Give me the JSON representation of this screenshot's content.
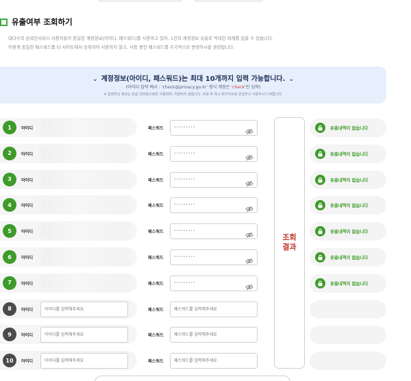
{
  "section": {
    "title": "유출여부 조회하기",
    "desc_line1": "대다수의 온라인서비스 사용자들이 동일한 계정정보(아이디, 패스워드)를 사용하고 있어, 1건의 계정정보 유출로 막대한 피해를 입을 수 있습니다.",
    "desc_line2": "이렇게 동일한 패스워드를 타 사이트에서 송복하여 사용하지 말고, 사용 중인 패스워드를 주기적으로 변경하시을 권장합니다."
  },
  "banner": {
    "title": "계정정보(아이디, 패스워드)는 최대 10개까지 입력 가능합니다.",
    "example_prefix": "(아이디 입력 예시 : 'check@privacy.go.kr' 형식 계정은 '",
    "example_highlight": "check",
    "example_suffix": "'만 입력)",
    "note": "※ 입력하신 정보는 단순 대조용으로만 사용되며, 저장되지 않습니다. 조회 후 즉시 파기되므로 안심하고 사용하시기 바랍니다."
  },
  "labels": {
    "id": "아이디",
    "password": "패스워드",
    "result": "조회결과",
    "result_line1": "조회",
    "result_line2": "결과",
    "status_ok": "유출내역이 없습니다"
  },
  "placeholders": {
    "id": "아이디를 입력해주세요",
    "password": "패스워드를 입력해주세요"
  },
  "masked_password": "•••••••••",
  "rows": [
    {
      "num": "1",
      "filled": true
    },
    {
      "num": "2",
      "filled": true
    },
    {
      "num": "3",
      "filled": true
    },
    {
      "num": "4",
      "filled": true
    },
    {
      "num": "5",
      "filled": true
    },
    {
      "num": "6",
      "filled": true
    },
    {
      "num": "7",
      "filled": true
    },
    {
      "num": "8",
      "filled": false
    },
    {
      "num": "9",
      "filled": false
    },
    {
      "num": "10",
      "filled": false
    }
  ],
  "colors": {
    "accent_green": "#3e9b2a",
    "result_red": "#c0392b",
    "banner_bg": "#e6effb"
  }
}
